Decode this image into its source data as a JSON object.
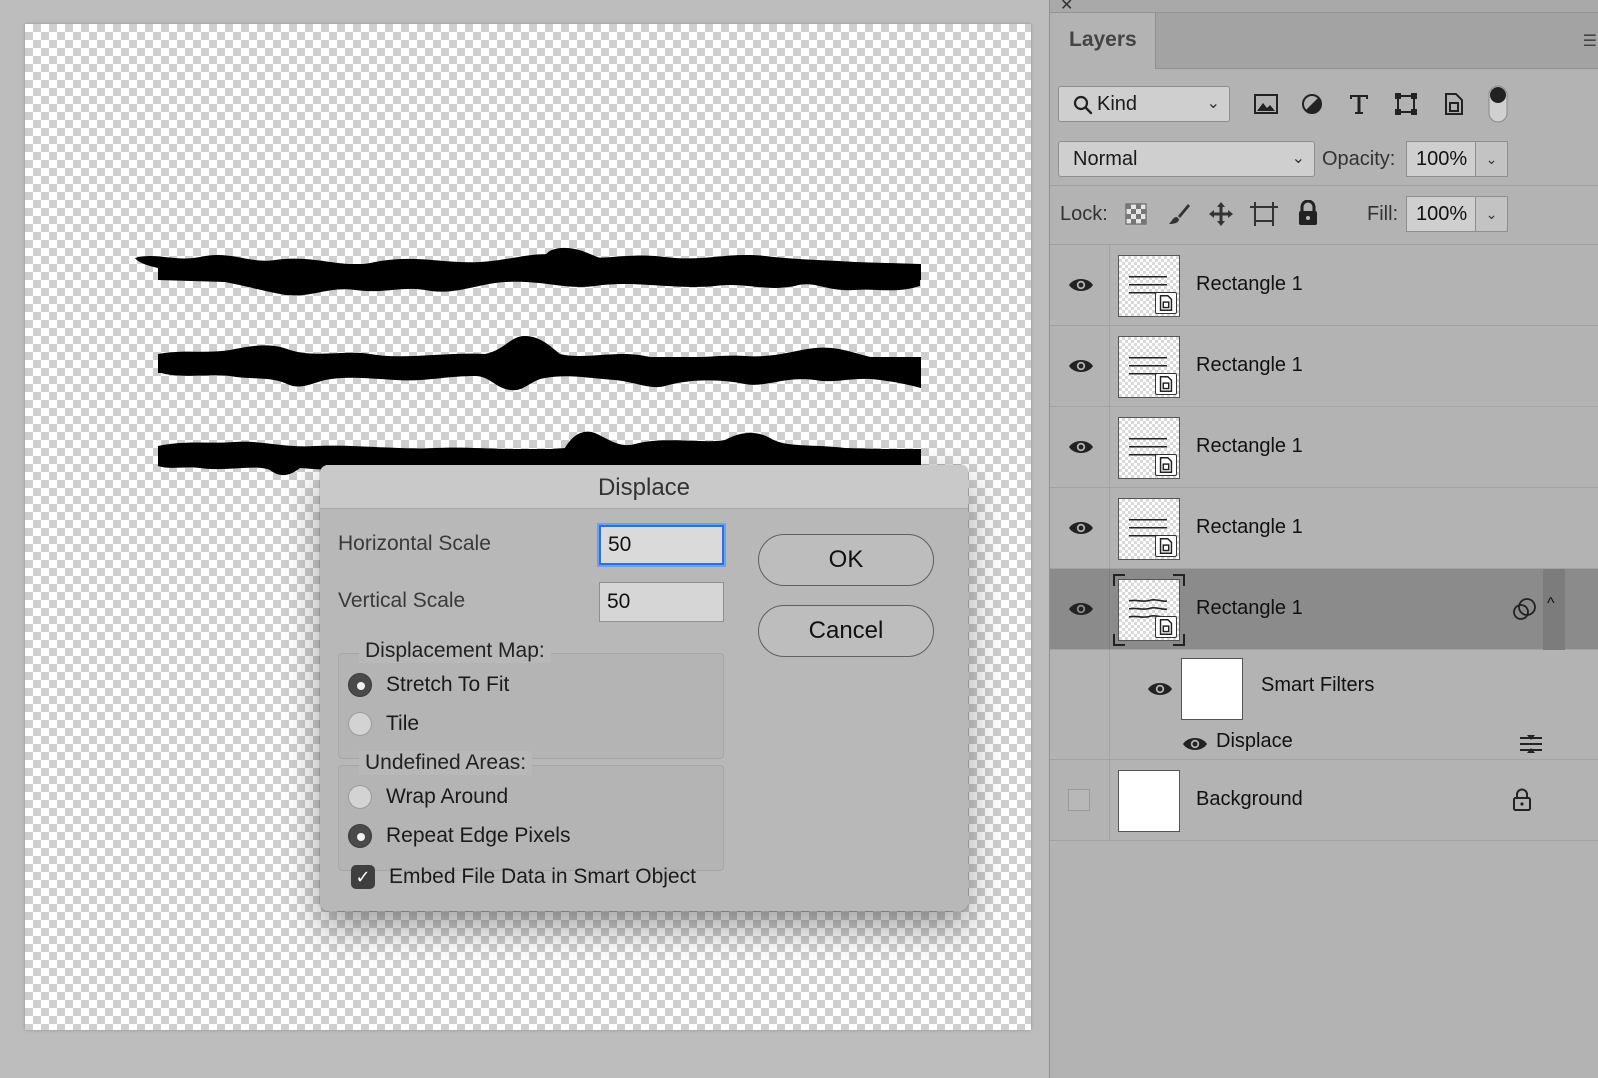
{
  "dialog": {
    "title": "Displace",
    "horizontal_scale_label": "Horizontal Scale",
    "horizontal_scale_value": "50",
    "vertical_scale_label": "Vertical Scale",
    "vertical_scale_value": "50",
    "ok_label": "OK",
    "cancel_label": "Cancel",
    "displacement_map_legend": "Displacement Map:",
    "stretch_to_fit_label": "Stretch To Fit",
    "tile_label": "Tile",
    "undefined_areas_legend": "Undefined Areas:",
    "wrap_around_label": "Wrap Around",
    "repeat_edge_pixels_label": "Repeat Edge Pixels",
    "embed_label": "Embed File Data in Smart Object",
    "displacement_map_selected": "Stretch To Fit",
    "undefined_areas_selected": "Repeat Edge Pixels",
    "embed_checked": true
  },
  "panel": {
    "tab_label": "Layers",
    "filter_kind": "Kind",
    "blend_mode": "Normal",
    "opacity_label": "Opacity:",
    "opacity_value": "100%",
    "lock_label": "Lock:",
    "fill_label": "Fill:",
    "fill_value": "100%",
    "filter_icons": [
      "image-filter-icon",
      "adjustment-filter-icon",
      "type-filter-icon",
      "shape-filter-icon",
      "smart-object-filter-icon",
      "filter-toggle-icon"
    ],
    "lock_icons": [
      "lock-transparent-pixels-icon",
      "lock-image-pixels-icon",
      "lock-position-icon",
      "lock-artboard-icon",
      "lock-all-icon"
    ]
  },
  "layers": [
    {
      "name": "Rectangle 1",
      "visible": true,
      "selected": false
    },
    {
      "name": "Rectangle 1",
      "visible": true,
      "selected": false
    },
    {
      "name": "Rectangle 1",
      "visible": true,
      "selected": false
    },
    {
      "name": "Rectangle 1",
      "visible": true,
      "selected": false
    },
    {
      "name": "Rectangle 1",
      "visible": true,
      "selected": true
    }
  ],
  "smart_filters": {
    "label": "Smart Filters",
    "filter_name": "Displace"
  },
  "background_layer": {
    "name": "Background",
    "visible": false,
    "locked": true
  },
  "colors": {
    "focus_ring": "#2f6fd6",
    "selected_row": "#8b8b8b",
    "panel_bg": "#b3b3b3"
  }
}
